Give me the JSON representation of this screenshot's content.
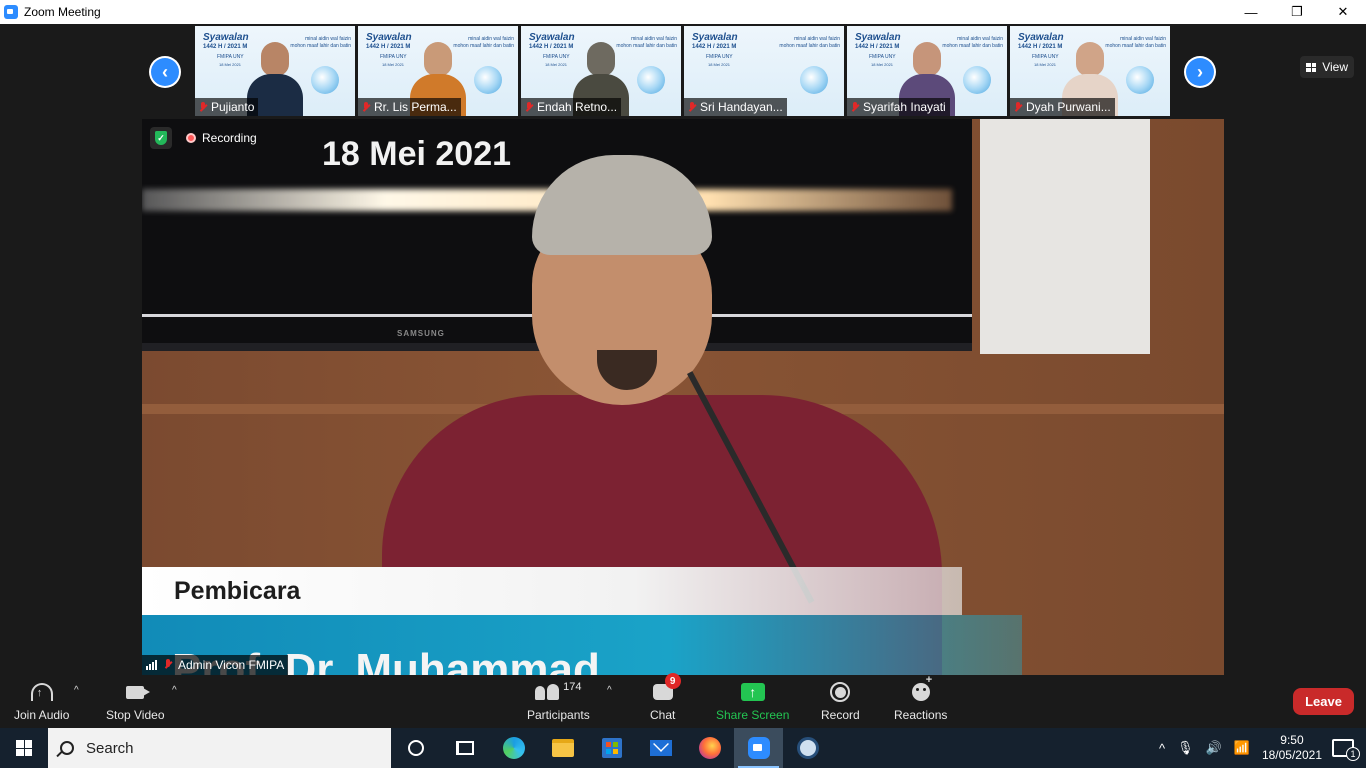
{
  "window": {
    "title": "Zoom Meeting",
    "minimize_icon": "minimize-icon",
    "restore_icon": "restore-icon",
    "close_icon": "close-icon",
    "min_glyph": "—",
    "restore_glyph": "❐",
    "close_glyph": "✕"
  },
  "gallery": {
    "prev_glyph": "‹",
    "next_glyph": "›",
    "view_label": "View",
    "tile_banner": {
      "title": "Syawalan",
      "year": "1442 H / 2021 M",
      "org": "FMIPA UNY",
      "date": "18 Mei 2021",
      "wish_line1": "minal aidin wal faizin",
      "wish_line2": "mohon maaf lahir dan batin"
    },
    "participants": [
      {
        "name": "Pujianto",
        "muted": true
      },
      {
        "name": "Rr. Lis Perma...",
        "muted": true
      },
      {
        "name": "Endah Retno...",
        "muted": true
      },
      {
        "name": "Sri Handayan...",
        "muted": true
      },
      {
        "name": "Syarifah Inayati",
        "muted": true
      },
      {
        "name": "Dyah Purwani...",
        "muted": true
      }
    ]
  },
  "main_video": {
    "recording_label": "Recording",
    "security_glyph": "✓",
    "slide_date": "18 Mei 2021",
    "tv_brand": "SAMSUNG",
    "lower_third_label": "Pembicara",
    "lower_third_name": "Prof. Dr. Muhammad",
    "participant_name": "Admin Vicon FMIPA"
  },
  "toolbar": {
    "join_audio": "Join Audio",
    "stop_video": "Stop Video",
    "participants": "Participants",
    "participants_count": "174",
    "chat": "Chat",
    "chat_badge": "9",
    "share_screen": "Share Screen",
    "share_glyph": "↑",
    "record": "Record",
    "reactions": "Reactions",
    "leave": "Leave",
    "caret_glyph": "^"
  },
  "taskbar": {
    "search_placeholder": "Search",
    "tray_chevron": "^",
    "tray_mic": "🎙",
    "tray_volume": "🔊",
    "tray_network": "📶",
    "time": "9:50",
    "date": "18/05/2021",
    "notification_count": "1",
    "accent": "#15212e"
  }
}
